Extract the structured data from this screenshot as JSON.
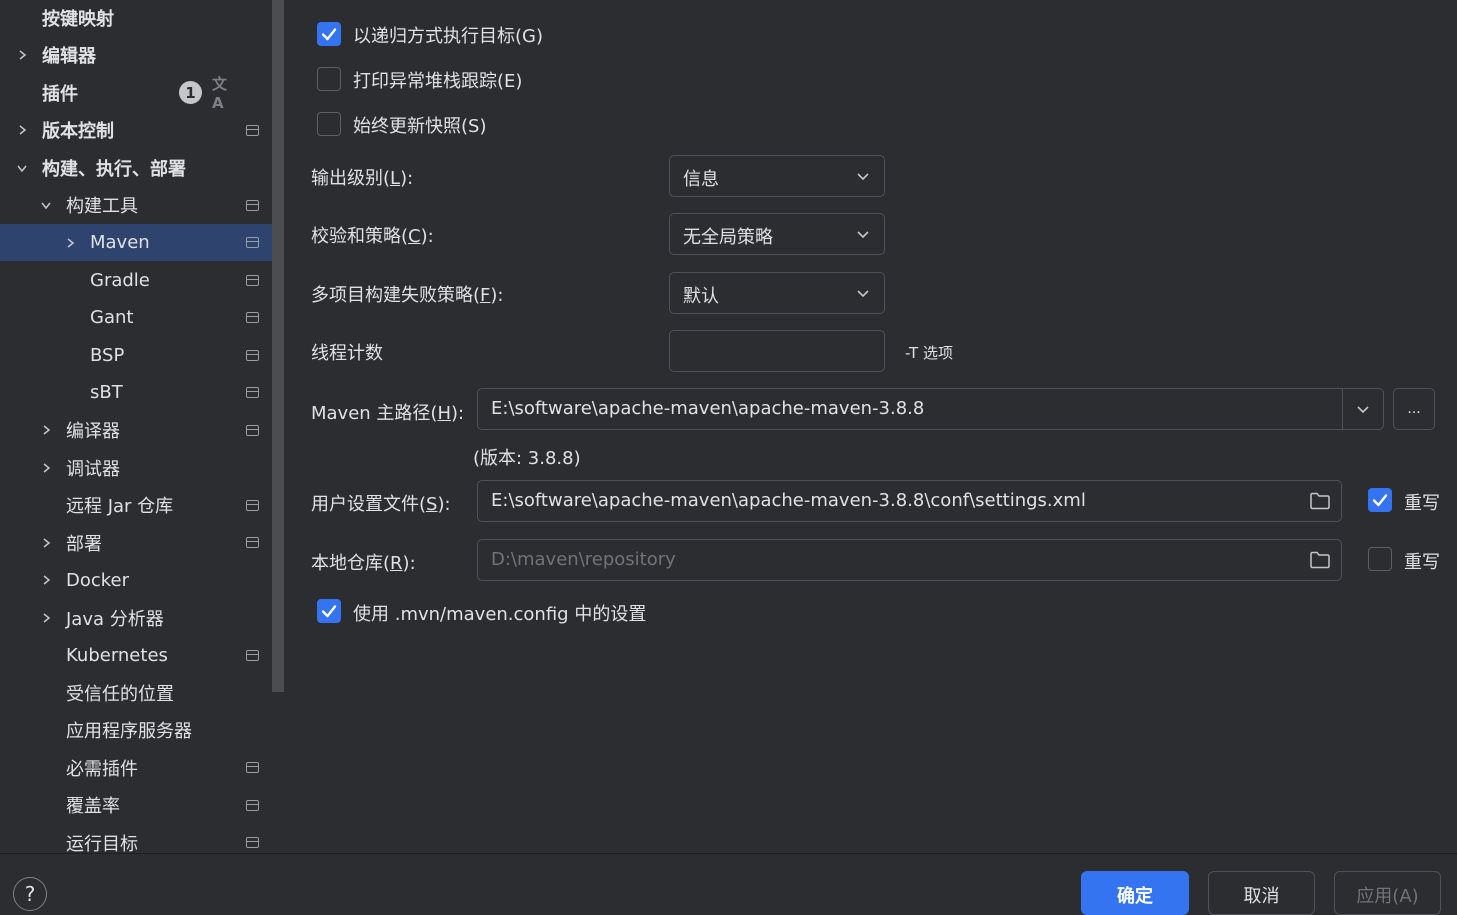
{
  "sidebar": {
    "items": [
      {
        "label": "按键映射",
        "indent": 0,
        "chevron": "none",
        "bold": true,
        "project": false
      },
      {
        "label": "编辑器",
        "indent": 0,
        "chevron": "right",
        "bold": true,
        "project": false
      },
      {
        "label": "插件",
        "indent": 0,
        "chevron": "none",
        "bold": true,
        "project": false,
        "badge": "1",
        "translate": "文A"
      },
      {
        "label": "版本控制",
        "indent": 0,
        "chevron": "right",
        "bold": true,
        "project": true
      },
      {
        "label": "构建、执行、部署",
        "indent": 0,
        "chevron": "down",
        "bold": true,
        "project": false
      },
      {
        "label": "构建工具",
        "indent": 1,
        "chevron": "down",
        "bold": false,
        "project": true
      },
      {
        "label": "Maven",
        "indent": 2,
        "chevron": "right",
        "bold": false,
        "project": true,
        "selected": true
      },
      {
        "label": "Gradle",
        "indent": 2,
        "chevron": "none",
        "bold": false,
        "project": true
      },
      {
        "label": "Gant",
        "indent": 2,
        "chevron": "none",
        "bold": false,
        "project": true
      },
      {
        "label": "BSP",
        "indent": 2,
        "chevron": "none",
        "bold": false,
        "project": true
      },
      {
        "label": "sBT",
        "indent": 2,
        "chevron": "none",
        "bold": false,
        "project": true
      },
      {
        "label": "编译器",
        "indent": 1,
        "chevron": "right",
        "bold": false,
        "project": true
      },
      {
        "label": "调试器",
        "indent": 1,
        "chevron": "right",
        "bold": false,
        "project": false
      },
      {
        "label": "远程 Jar 仓库",
        "indent": 1,
        "chevron": "none",
        "bold": false,
        "project": true
      },
      {
        "label": "部署",
        "indent": 1,
        "chevron": "right",
        "bold": false,
        "project": true
      },
      {
        "label": "Docker",
        "indent": 1,
        "chevron": "right",
        "bold": false,
        "project": false
      },
      {
        "label": "Java 分析器",
        "indent": 1,
        "chevron": "right",
        "bold": false,
        "project": false
      },
      {
        "label": "Kubernetes",
        "indent": 1,
        "chevron": "none",
        "bold": false,
        "project": true
      },
      {
        "label": "受信任的位置",
        "indent": 1,
        "chevron": "none",
        "bold": false,
        "project": false
      },
      {
        "label": "应用程序服务器",
        "indent": 1,
        "chevron": "none",
        "bold": false,
        "project": false
      },
      {
        "label": "必需插件",
        "indent": 1,
        "chevron": "none",
        "bold": false,
        "project": true
      },
      {
        "label": "覆盖率",
        "indent": 1,
        "chevron": "none",
        "bold": false,
        "project": true
      },
      {
        "label": "运行目标",
        "indent": 1,
        "chevron": "none",
        "bold": false,
        "project": true
      }
    ]
  },
  "options": {
    "recursive": {
      "label": "以递归方式执行目标(G)",
      "checked": true
    },
    "print_stack": {
      "label": "打印异常堆栈跟踪(E)",
      "checked": false
    },
    "always_update": {
      "label": "始终更新快照(S)",
      "checked": false
    }
  },
  "output_level": {
    "label_pre": "输出级别(",
    "mnemonic": "L",
    "label_post": "):",
    "value": "信息"
  },
  "checksum_policy": {
    "label_pre": "校验和策略(",
    "mnemonic": "C",
    "label_post": "):",
    "value": "无全局策略"
  },
  "fail_policy": {
    "label_pre": "多项目构建失败策略(",
    "mnemonic": "F",
    "label_post": "):",
    "value": "默认"
  },
  "thread_count": {
    "label": "线程计数",
    "value": "",
    "hint": "-T 选项"
  },
  "maven_home": {
    "label_pre": "Maven 主路径(",
    "mnemonic": "H",
    "label_post": "):",
    "value": "E:\\software\\apache-maven\\apache-maven-3.8.8",
    "browse": "...",
    "version": "(版本: 3.8.8)"
  },
  "user_settings": {
    "label_pre": "用户设置文件(",
    "mnemonic": "S",
    "label_post": "):",
    "value": "E:\\software\\apache-maven\\apache-maven-3.8.8\\conf\\settings.xml",
    "override_label": "重写",
    "override": true
  },
  "local_repo": {
    "label_pre": "本地仓库(",
    "mnemonic": "R",
    "label_post": "):",
    "value": "D:\\maven\\repository",
    "override_label": "重写",
    "override": false
  },
  "use_mvn_config": {
    "label": "使用 .mvn/maven.config 中的设置",
    "checked": true
  },
  "footer": {
    "help": "?",
    "ok": "确定",
    "cancel": "取消",
    "apply": "应用(A)"
  },
  "colors": {
    "accent": "#3574f0",
    "selection": "#2e436e",
    "background": "#2b2d30"
  }
}
